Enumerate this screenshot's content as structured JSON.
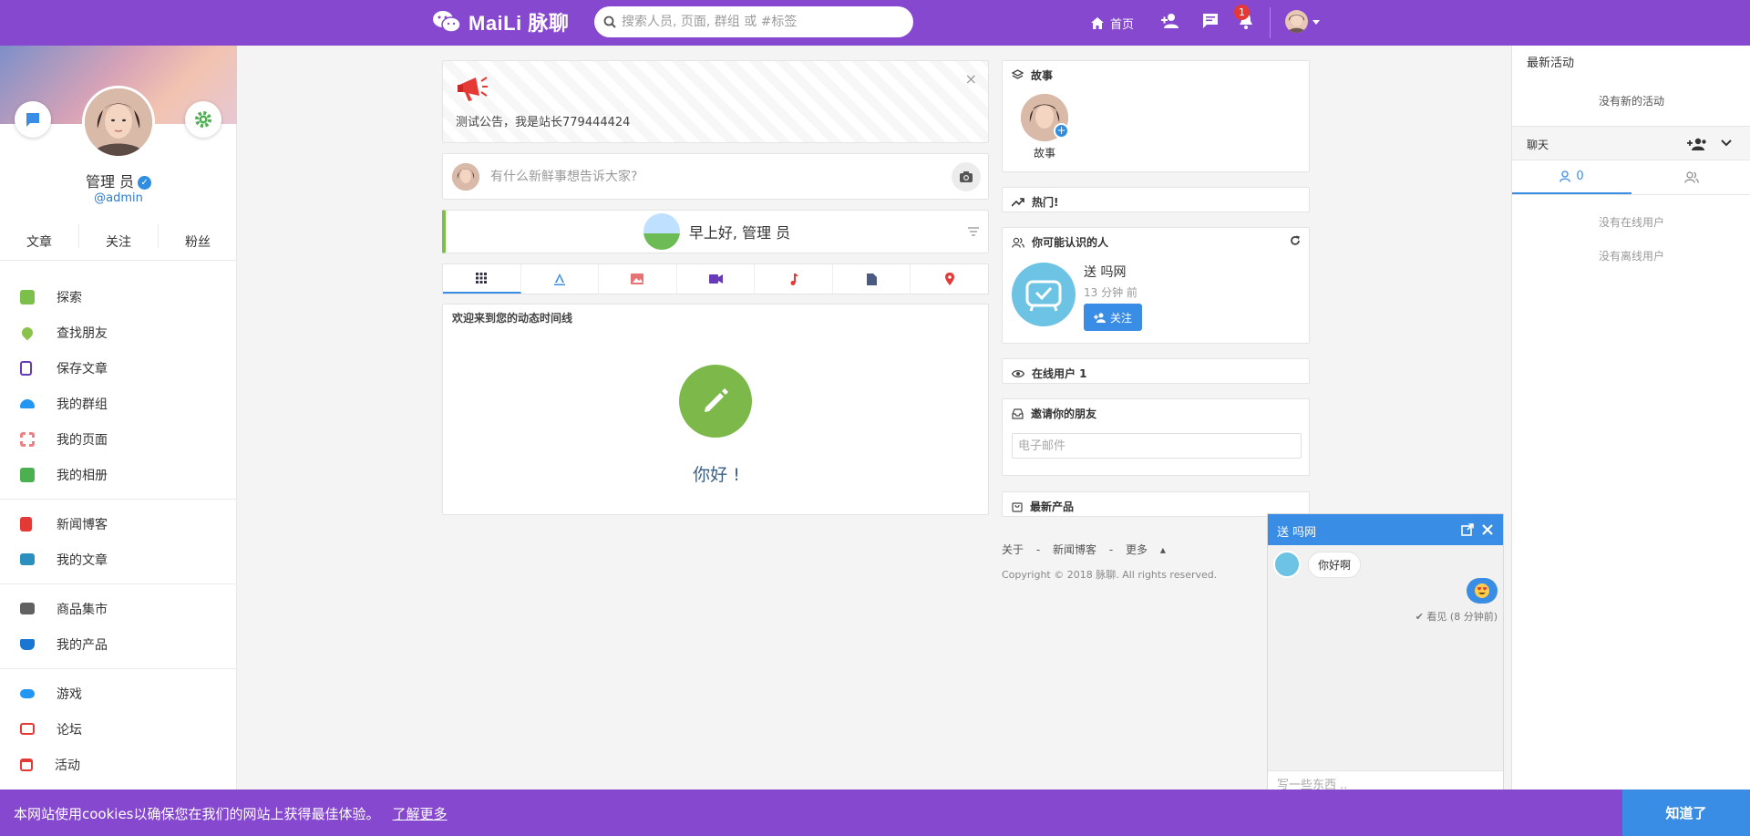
{
  "header": {
    "brand": "MaiLi 脉聊",
    "search_placeholder": "搜索人员, 页面, 群组 或 #标签",
    "home_label": "首页",
    "notification_count": "1"
  },
  "profile": {
    "name": "管理 员",
    "handle": "@admin",
    "stats": [
      "文章",
      "关注",
      "粉丝"
    ]
  },
  "sidebar": {
    "group1": [
      {
        "label": "探索",
        "icon": "explore-icon",
        "color": "#7cc04b"
      },
      {
        "label": "查找朋友",
        "icon": "map-pin-icon",
        "color": "#8bc34a"
      },
      {
        "label": "保存文章",
        "icon": "bookmark-icon",
        "color": "#673ab7"
      },
      {
        "label": "我的群组",
        "icon": "users-icon",
        "color": "#2196f3"
      },
      {
        "label": "我的页面",
        "icon": "flag-icon",
        "color": "#f08080"
      },
      {
        "label": "我的相册",
        "icon": "photo-icon",
        "color": "#4caf50"
      }
    ],
    "group2": [
      {
        "label": "新闻博客",
        "icon": "book-icon",
        "color": "#e53935"
      },
      {
        "label": "我的文章",
        "icon": "open-book-icon",
        "color": "#2a8fbd"
      }
    ],
    "group3": [
      {
        "label": "商品集市",
        "icon": "store-icon",
        "color": "#616161"
      },
      {
        "label": "我的产品",
        "icon": "cart-icon",
        "color": "#1976d2"
      }
    ],
    "group4": [
      {
        "label": "游戏",
        "icon": "gamepad-icon",
        "color": "#2196f3"
      },
      {
        "label": "论坛",
        "icon": "forum-icon",
        "color": "#e53935"
      },
      {
        "label": "活动",
        "icon": "calendar-icon",
        "color": "#e53935"
      }
    ]
  },
  "announcement": {
    "text": "测试公告，我是站长779444424"
  },
  "composer": {
    "placeholder": "有什么新鲜事想告诉大家?"
  },
  "greeting": {
    "text": "早上好, 管理 员"
  },
  "feed": {
    "title": "欢迎来到您的动态时间线",
    "hello": "你好 !"
  },
  "widgets": {
    "stories": {
      "title": "故事",
      "item_label": "故事"
    },
    "trending": {
      "title": "热门!"
    },
    "suggest": {
      "title": "你可能认识的人",
      "name": "送 吗网",
      "time": "13 分钟 前",
      "follow": "关注"
    },
    "online": {
      "title": "在线用户 1"
    },
    "invite": {
      "title": "邀请你的朋友",
      "placeholder": "电子邮件"
    },
    "products": {
      "title": "最新产品"
    }
  },
  "footer": {
    "links": [
      "关于",
      "-",
      "新闻博客",
      "-",
      "更多"
    ],
    "copyright": "Copyright © 2018 脉聊. All rights reserved."
  },
  "right_panel": {
    "activity_title": "最新活动",
    "no_activity": "没有新的活动",
    "chat_title": "聊天",
    "online_count": "0",
    "no_online": "没有在线用户",
    "no_offline": "没有离线用户"
  },
  "chat_window": {
    "name": "送 吗网",
    "incoming": "你好啊",
    "seen": "看见 (8 分钟前)",
    "input_placeholder": "写一些东西 .."
  },
  "cookie": {
    "message": "本网站使用cookies以确保您在我们的网站上获得最佳体验。",
    "learn_more": "了解更多",
    "accept": "知道了"
  },
  "colors": {
    "brand": "#8648cf",
    "accent": "#3a8de4",
    "green": "#7cb94a"
  }
}
